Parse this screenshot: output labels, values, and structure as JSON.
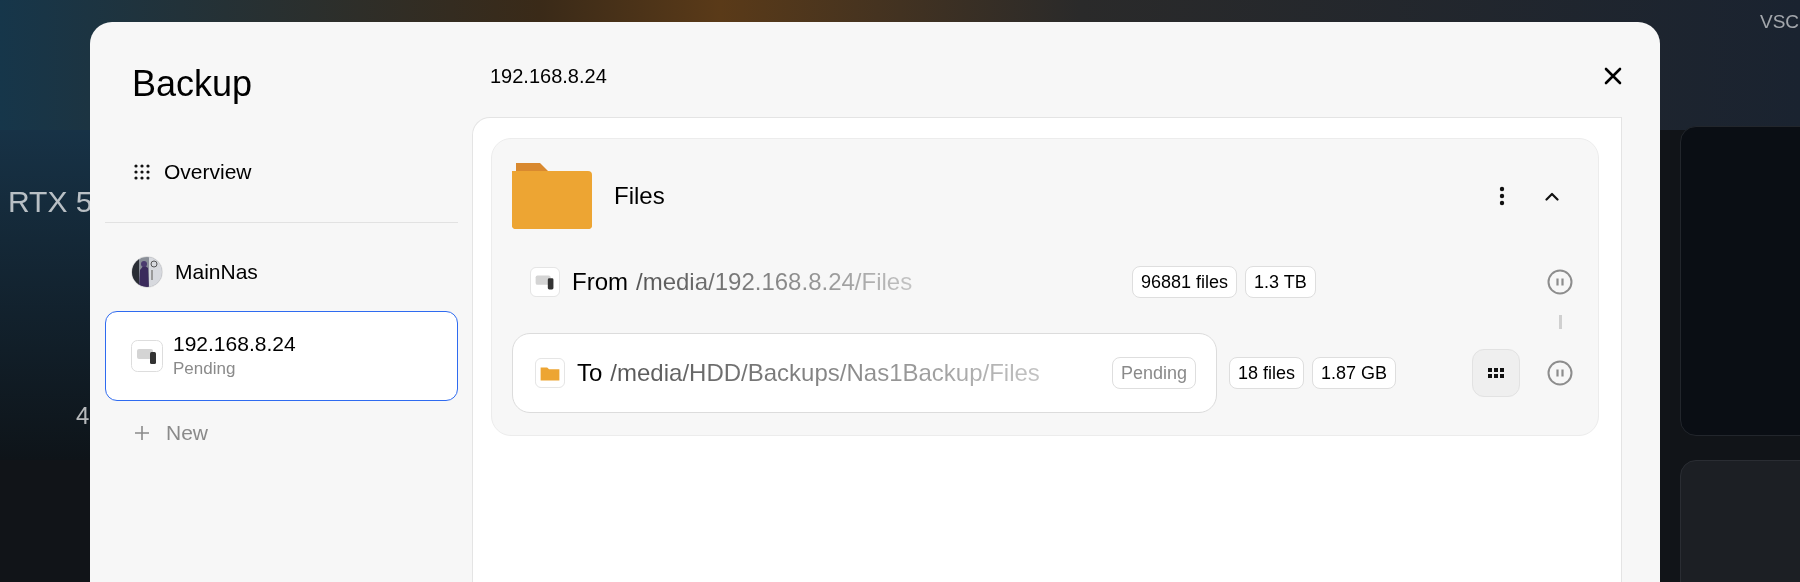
{
  "background": {
    "top_labels": [
      "VSC"
    ],
    "side_labels": [
      "RTX 5",
      "4"
    ]
  },
  "dialog": {
    "title": "Backup",
    "header": "192.168.8.24"
  },
  "sidebar": {
    "items": [
      {
        "kind": "overview",
        "label": "Overview",
        "selected": false
      },
      {
        "kind": "avatar",
        "label": "MainNas",
        "selected": false
      },
      {
        "kind": "drive",
        "label": "192.168.8.24",
        "sublabel": "Pending",
        "selected": true
      },
      {
        "kind": "new",
        "label": "New",
        "selected": false
      }
    ]
  },
  "job": {
    "title": "Files",
    "expanded": true,
    "source": {
      "label": "From",
      "path": "/media/192.168.8.24/Files",
      "file_count": "96881 files",
      "size": "1.3 TB"
    },
    "destination": {
      "label": "To",
      "path": "/media/HDD/Backups/Nas1Backup/Files",
      "status": "Pending",
      "file_count": "18 files",
      "size": "1.87 GB"
    }
  }
}
